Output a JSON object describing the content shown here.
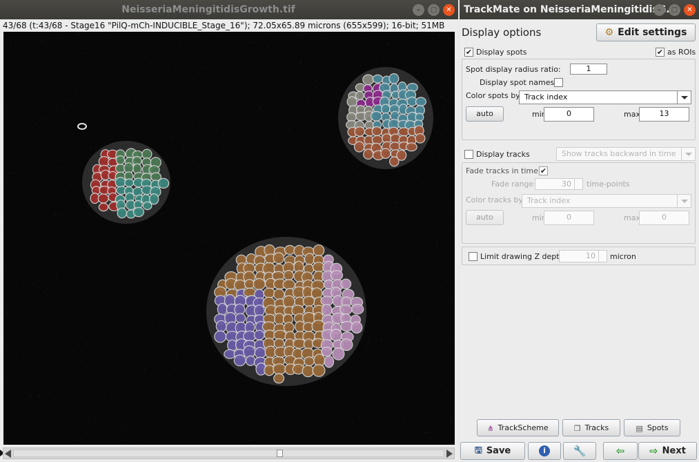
{
  "image_window": {
    "title": "NeisseriaMeningitidisGrowth.tif",
    "info": "43/68 (t:43/68 - Stage16 \"PilQ-mCh-INDUCIBLE_Stage_16\"); 72.05x65.89 microns (655x599); 16-bit; 51MB",
    "frame_position": 0.62
  },
  "trackmate": {
    "title": "TrackMate on NeisseriaMeningitidisG...",
    "panel_title": "Display options",
    "edit_settings_label": "Edit settings",
    "display_spots_label": "Display spots",
    "display_spots_checked": true,
    "as_rois_label": "as ROIs",
    "as_rois_checked": true,
    "spot_radius_label": "Spot display radius ratio:",
    "spot_radius_value": "1",
    "display_spot_names_label": "Display spot names:",
    "display_spot_names_checked": false,
    "color_spots_label": "Color spots by:",
    "color_spots_value": "Track index",
    "auto_label": "auto",
    "min_label": "min",
    "min_value": "0",
    "max_label": "max",
    "max_value": "13",
    "display_tracks_label": "Display tracks",
    "display_tracks_checked": false,
    "track_mode_value": "Show tracks backward in time",
    "fade_tracks_label": "Fade tracks in time:",
    "fade_tracks_checked": true,
    "fade_range_label": "Fade range:",
    "fade_range_value": "30",
    "fade_unit": "time-points",
    "color_tracks_label": "Color tracks by:",
    "color_tracks_value": "Track index",
    "track_auto_label": "auto",
    "track_min_label": "min",
    "track_min_value": "0",
    "track_max_label": "max",
    "track_max_value": "0",
    "limit_z_label": "Limit drawing Z depth",
    "limit_z_checked": false,
    "limit_z_value": "10",
    "limit_z_unit": "micron",
    "trackscheme_label": "TrackScheme",
    "tracks_label": "Tracks",
    "spots_label": "Spots",
    "save_label": "Save",
    "next_label": "Next"
  }
}
